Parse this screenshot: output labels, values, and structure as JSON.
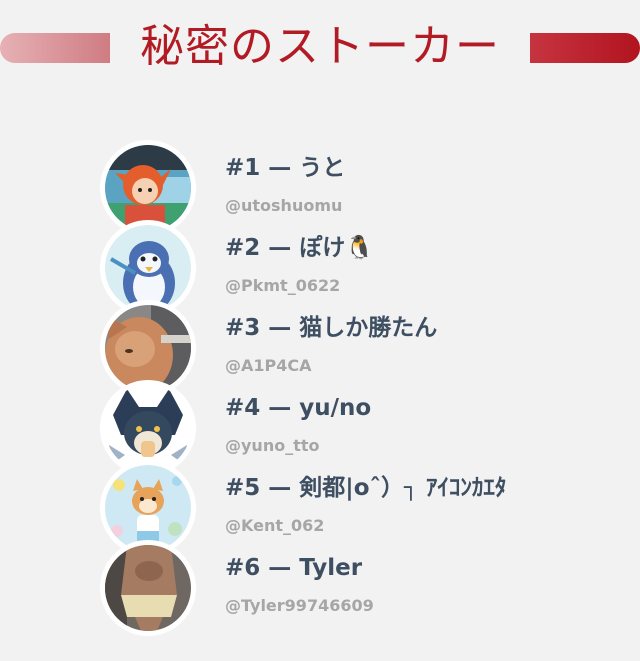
{
  "header": {
    "title": "秘密のストーカー"
  },
  "stalkers": [
    {
      "rank": "#1 — うと",
      "handle": "@utoshuomu"
    },
    {
      "rank": "#2 — ぽけ🐧",
      "handle": "@Pkmt_0622"
    },
    {
      "rank": "#3 — 猫しか勝たん",
      "handle": "@A1P4CA"
    },
    {
      "rank": "#4 — yu/no",
      "handle": "@yuno_tto"
    },
    {
      "rank": "#5 — 剣都|oˆ）┐ ｱｲｺﾝｶｴﾀ",
      "handle": "@Kent_062"
    },
    {
      "rank": "#6 — Tyler",
      "handle": "@Tyler99746609"
    }
  ],
  "colors": {
    "accent": "#b21b24",
    "name": "#3e4f62",
    "handle": "#a6a6a6",
    "background": "#f2f2f2"
  }
}
